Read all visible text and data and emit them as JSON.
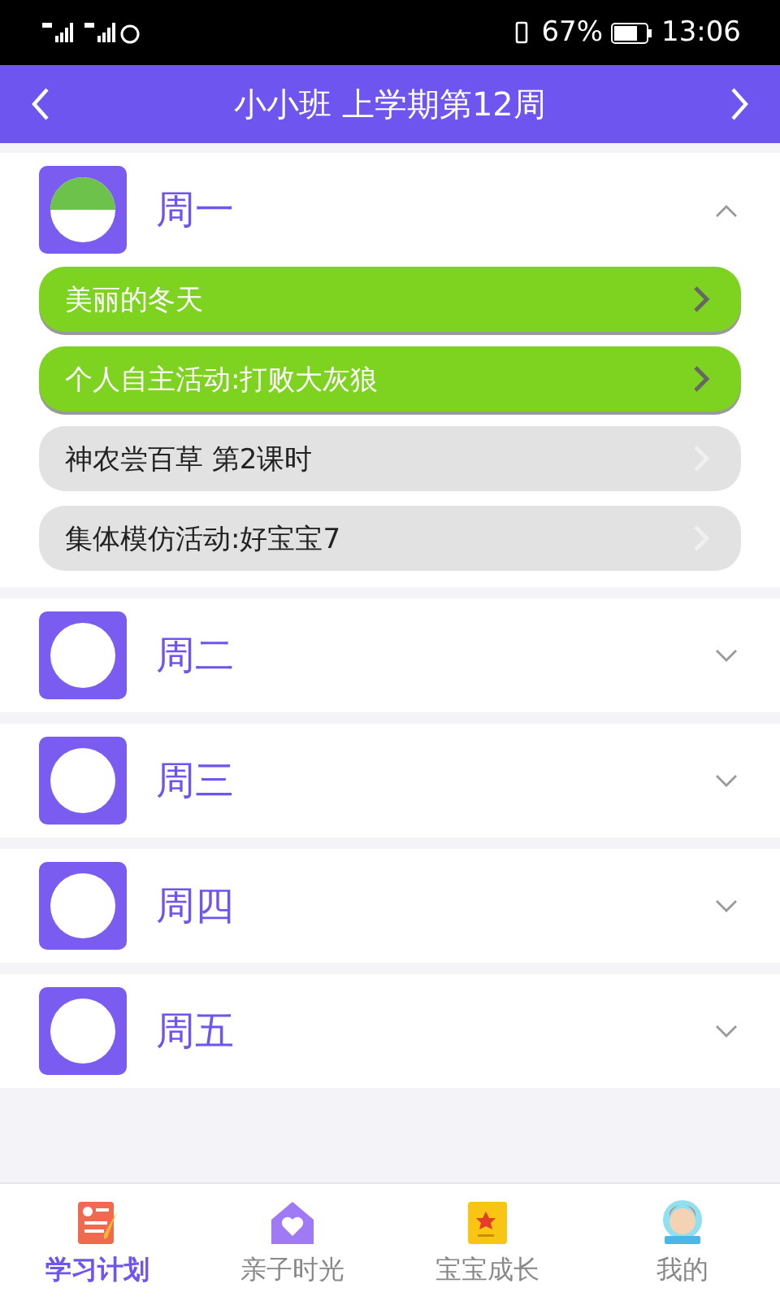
{
  "status_bar": {
    "battery": "67%",
    "time": "13:06"
  },
  "header": {
    "title": "小小班 上学期第12周"
  },
  "days": [
    {
      "label": "周一",
      "expanded": true,
      "lessons": [
        {
          "title": "美丽的冬天",
          "completed": true
        },
        {
          "title": "个人自主活动:打败大灰狼",
          "completed": true
        },
        {
          "title": "神农尝百草 第2课时",
          "completed": false
        },
        {
          "title": "集体模仿活动:好宝宝7",
          "completed": false
        }
      ]
    },
    {
      "label": "周二",
      "expanded": false
    },
    {
      "label": "周三",
      "expanded": false
    },
    {
      "label": "周四",
      "expanded": false
    },
    {
      "label": "周五",
      "expanded": false
    }
  ],
  "tabs": [
    {
      "label": "学习计划",
      "kind": "plan",
      "selected": true
    },
    {
      "label": "亲子时光",
      "kind": "home",
      "selected": false
    },
    {
      "label": "宝宝成长",
      "kind": "growth",
      "selected": false
    },
    {
      "label": "我的",
      "kind": "me",
      "selected": false
    }
  ]
}
